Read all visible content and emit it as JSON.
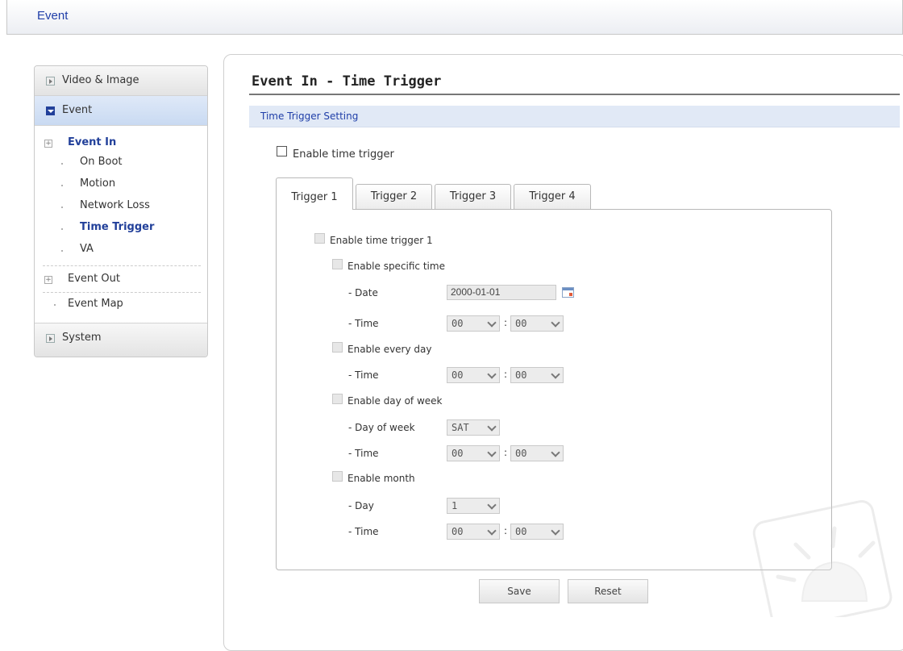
{
  "header": {
    "title": "Event"
  },
  "sidebar": {
    "video_image": "Video & Image",
    "event": "Event",
    "event_in": "Event In",
    "event_in_items": [
      "On Boot",
      "Motion",
      "Network Loss",
      "Time Trigger",
      "VA"
    ],
    "event_out": "Event Out",
    "event_map": "Event Map",
    "system": "System"
  },
  "main": {
    "title": "Event In - Time Trigger",
    "section": "Time Trigger Setting",
    "enable_time_trigger": "Enable time trigger",
    "tabs": [
      "Trigger 1",
      "Trigger 2",
      "Trigger 3",
      "Trigger 4"
    ],
    "enable_trigger_1": "Enable time trigger 1",
    "enable_specific_time": "Enable specific time",
    "date_label": "- Date",
    "date_value": "2000-01-01",
    "time_label": "- Time",
    "hour": "00",
    "minute": "00",
    "colon": ":",
    "enable_every_day": "Enable every day",
    "enable_day_of_week": "Enable day of week",
    "day_of_week_label": "- Day of week",
    "day_of_week_value": "SAT",
    "enable_month": "Enable month",
    "day_label": "- Day",
    "day_value": "1",
    "save": "Save",
    "reset": "Reset"
  }
}
